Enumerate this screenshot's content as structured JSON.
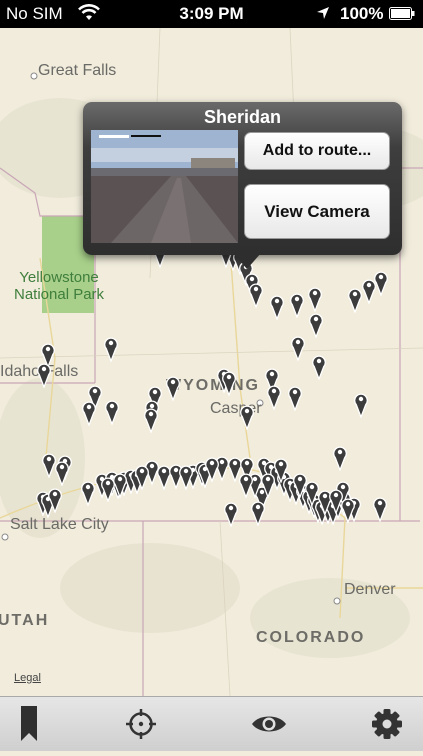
{
  "status_bar": {
    "carrier": "No SIM",
    "time": "3:09 PM",
    "battery": "100%",
    "icons": [
      "wifi-icon",
      "location-arrow-icon",
      "battery-icon"
    ]
  },
  "map": {
    "labels": {
      "great_falls": "Great Falls",
      "yellowstone": "Yellowstone\nNational Park",
      "idaho_falls": "Idaho Falls",
      "wyoming": "WYOMING",
      "casper": "Casper",
      "salt_lake": "Salt Lake City",
      "denver": "Denver",
      "colorado": "COLORADO",
      "utah": "UTAH",
      "legal": "Legal"
    },
    "camera_pin_count": 92
  },
  "callout": {
    "title": "Sheridan",
    "add_button": "Add to route...",
    "view_button": "View Camera"
  },
  "toolbar": {
    "items": [
      "bookmark-icon",
      "locate-icon",
      "eye-icon",
      "settings-gear-icon"
    ]
  },
  "colors": {
    "map_land": "#f1ecdc",
    "park_green": "#a8d08a",
    "pin_dark": "#3c3c3c",
    "callout_bg": "#2e2e2e"
  }
}
